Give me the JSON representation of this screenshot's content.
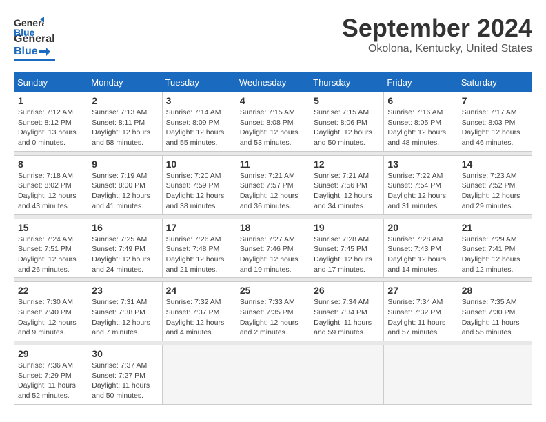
{
  "header": {
    "logo_general": "General",
    "logo_blue": "Blue",
    "month_title": "September 2024",
    "location": "Okolona, Kentucky, United States"
  },
  "days_of_week": [
    "Sunday",
    "Monday",
    "Tuesday",
    "Wednesday",
    "Thursday",
    "Friday",
    "Saturday"
  ],
  "weeks": [
    [
      {
        "day": "1",
        "info": "Sunrise: 7:12 AM\nSunset: 8:12 PM\nDaylight: 13 hours\nand 0 minutes."
      },
      {
        "day": "2",
        "info": "Sunrise: 7:13 AM\nSunset: 8:11 PM\nDaylight: 12 hours\nand 58 minutes."
      },
      {
        "day": "3",
        "info": "Sunrise: 7:14 AM\nSunset: 8:09 PM\nDaylight: 12 hours\nand 55 minutes."
      },
      {
        "day": "4",
        "info": "Sunrise: 7:15 AM\nSunset: 8:08 PM\nDaylight: 12 hours\nand 53 minutes."
      },
      {
        "day": "5",
        "info": "Sunrise: 7:15 AM\nSunset: 8:06 PM\nDaylight: 12 hours\nand 50 minutes."
      },
      {
        "day": "6",
        "info": "Sunrise: 7:16 AM\nSunset: 8:05 PM\nDaylight: 12 hours\nand 48 minutes."
      },
      {
        "day": "7",
        "info": "Sunrise: 7:17 AM\nSunset: 8:03 PM\nDaylight: 12 hours\nand 46 minutes."
      }
    ],
    [
      {
        "day": "8",
        "info": "Sunrise: 7:18 AM\nSunset: 8:02 PM\nDaylight: 12 hours\nand 43 minutes."
      },
      {
        "day": "9",
        "info": "Sunrise: 7:19 AM\nSunset: 8:00 PM\nDaylight: 12 hours\nand 41 minutes."
      },
      {
        "day": "10",
        "info": "Sunrise: 7:20 AM\nSunset: 7:59 PM\nDaylight: 12 hours\nand 38 minutes."
      },
      {
        "day": "11",
        "info": "Sunrise: 7:21 AM\nSunset: 7:57 PM\nDaylight: 12 hours\nand 36 minutes."
      },
      {
        "day": "12",
        "info": "Sunrise: 7:21 AM\nSunset: 7:56 PM\nDaylight: 12 hours\nand 34 minutes."
      },
      {
        "day": "13",
        "info": "Sunrise: 7:22 AM\nSunset: 7:54 PM\nDaylight: 12 hours\nand 31 minutes."
      },
      {
        "day": "14",
        "info": "Sunrise: 7:23 AM\nSunset: 7:52 PM\nDaylight: 12 hours\nand 29 minutes."
      }
    ],
    [
      {
        "day": "15",
        "info": "Sunrise: 7:24 AM\nSunset: 7:51 PM\nDaylight: 12 hours\nand 26 minutes."
      },
      {
        "day": "16",
        "info": "Sunrise: 7:25 AM\nSunset: 7:49 PM\nDaylight: 12 hours\nand 24 minutes."
      },
      {
        "day": "17",
        "info": "Sunrise: 7:26 AM\nSunset: 7:48 PM\nDaylight: 12 hours\nand 21 minutes."
      },
      {
        "day": "18",
        "info": "Sunrise: 7:27 AM\nSunset: 7:46 PM\nDaylight: 12 hours\nand 19 minutes."
      },
      {
        "day": "19",
        "info": "Sunrise: 7:28 AM\nSunset: 7:45 PM\nDaylight: 12 hours\nand 17 minutes."
      },
      {
        "day": "20",
        "info": "Sunrise: 7:28 AM\nSunset: 7:43 PM\nDaylight: 12 hours\nand 14 minutes."
      },
      {
        "day": "21",
        "info": "Sunrise: 7:29 AM\nSunset: 7:41 PM\nDaylight: 12 hours\nand 12 minutes."
      }
    ],
    [
      {
        "day": "22",
        "info": "Sunrise: 7:30 AM\nSunset: 7:40 PM\nDaylight: 12 hours\nand 9 minutes."
      },
      {
        "day": "23",
        "info": "Sunrise: 7:31 AM\nSunset: 7:38 PM\nDaylight: 12 hours\nand 7 minutes."
      },
      {
        "day": "24",
        "info": "Sunrise: 7:32 AM\nSunset: 7:37 PM\nDaylight: 12 hours\nand 4 minutes."
      },
      {
        "day": "25",
        "info": "Sunrise: 7:33 AM\nSunset: 7:35 PM\nDaylight: 12 hours\nand 2 minutes."
      },
      {
        "day": "26",
        "info": "Sunrise: 7:34 AM\nSunset: 7:34 PM\nDaylight: 11 hours\nand 59 minutes."
      },
      {
        "day": "27",
        "info": "Sunrise: 7:34 AM\nSunset: 7:32 PM\nDaylight: 11 hours\nand 57 minutes."
      },
      {
        "day": "28",
        "info": "Sunrise: 7:35 AM\nSunset: 7:30 PM\nDaylight: 11 hours\nand 55 minutes."
      }
    ],
    [
      {
        "day": "29",
        "info": "Sunrise: 7:36 AM\nSunset: 7:29 PM\nDaylight: 11 hours\nand 52 minutes."
      },
      {
        "day": "30",
        "info": "Sunrise: 7:37 AM\nSunset: 7:27 PM\nDaylight: 11 hours\nand 50 minutes."
      },
      {
        "day": "",
        "info": ""
      },
      {
        "day": "",
        "info": ""
      },
      {
        "day": "",
        "info": ""
      },
      {
        "day": "",
        "info": ""
      },
      {
        "day": "",
        "info": ""
      }
    ]
  ]
}
